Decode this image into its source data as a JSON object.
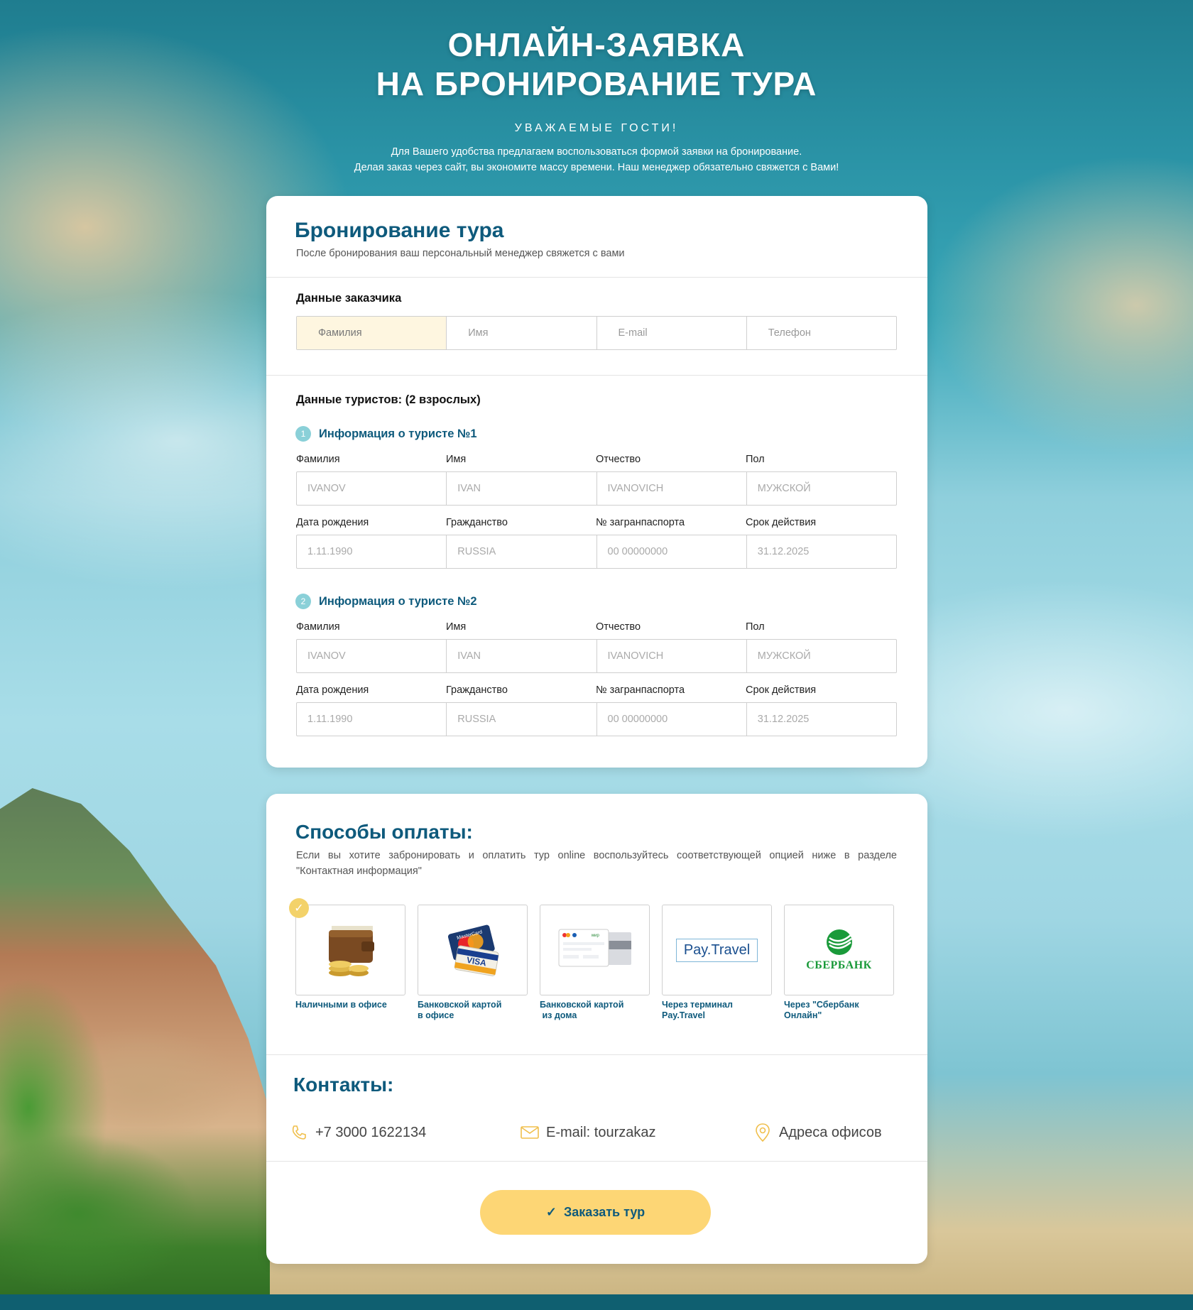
{
  "hero": {
    "title_line1": "ОНЛАЙН-ЗАЯВКА",
    "title_line2": "НА БРОНИРОВАНИЕ ТУРА",
    "subtitle": "УВАЖАЕМЫЕ ГОСТИ!",
    "desc_line1": "Для Вашего удобства предлагаем воспользоваться формой заявки на бронирование.",
    "desc_line2": "Делая заказ через сайт, вы экономите массу  времени. Наш менеджер обязательно свяжется с Вами!"
  },
  "booking": {
    "title": "Бронирование тура",
    "subtitle": "После бронирования ваш персональный менеджер свяжется с вами",
    "customer_label": "Данные заказчика",
    "customer_fields": [
      "Фамилия",
      "Имя",
      "E-mail",
      "Телефон"
    ],
    "tourists_label": "Данные туристов: (2 взрослых)",
    "tourists": [
      {
        "num": "1",
        "title": "Информация о туристе №1",
        "row1_labels": [
          "Фамилия",
          "Имя",
          "Отчество",
          "Пол"
        ],
        "row1_values": [
          "IVANOV",
          "IVAN",
          "IVANOVICH",
          "МУЖСКОЙ"
        ],
        "row2_labels": [
          "Дата рождения",
          "Гражданство",
          "№ загранпаспорта",
          "Срок действия"
        ],
        "row2_values": [
          "1.11.1990",
          "RUSSIA",
          "00 00000000",
          "31.12.2025"
        ]
      },
      {
        "num": "2",
        "title": "Информация о туристе №2",
        "row1_labels": [
          "Фамилия",
          "Имя",
          "Отчество",
          "Пол"
        ],
        "row1_values": [
          "IVANOV",
          "IVAN",
          "IVANOVICH",
          "МУЖСКОЙ"
        ],
        "row2_labels": [
          "Дата рождения",
          "Гражданство",
          "№ загранпаспорта",
          "Срок действия"
        ],
        "row2_values": [
          "1.11.1990",
          "RUSSIA",
          "00 00000000",
          "31.12.2025"
        ]
      }
    ]
  },
  "payment": {
    "title": "Способы оплаты:",
    "desc_line1": "Если вы хотите забронировать и оплатить тур online воспользуйтесь соответствующей опцией ниже в разделе",
    "desc_line2": "\"Контактная информация\"",
    "selected_index": 0,
    "options": [
      {
        "line1": "Наличными в офисе",
        "line2": "",
        "icon": "wallet-icon"
      },
      {
        "line1": "Банковской картой",
        "line2": "в офисе",
        "icon": "cards-icon"
      },
      {
        "line1": "Банковской картой",
        "line2": " из дома",
        "icon": "online-card-icon"
      },
      {
        "line1": "Через терминал",
        "line2": "Pay.Travel",
        "icon": "paytravel-logo"
      },
      {
        "line1": "Через \"Сбербанк",
        "line2": "Онлайн\"",
        "icon": "sberbank-logo"
      }
    ],
    "paytravel_text": "Pay.Travel",
    "sber_text": "СБЕРБАНК",
    "card_brand_1": "MasterCard",
    "card_brand_2": "VISA",
    "online_card_tag": "мир"
  },
  "contacts": {
    "title": "Контакты:",
    "phone": "+7 3000 1622134",
    "email": "E-mail: tourzakaz",
    "address": "Адреса офисов"
  },
  "order_button": {
    "label": "Заказать тур",
    "icon": "✓"
  },
  "colors": {
    "primary": "#0e5a7c",
    "accent": "#fdd675",
    "highlight_field": "#fef6e0",
    "footer": "#0f5f70",
    "sber_green": "#1a9a3a"
  }
}
